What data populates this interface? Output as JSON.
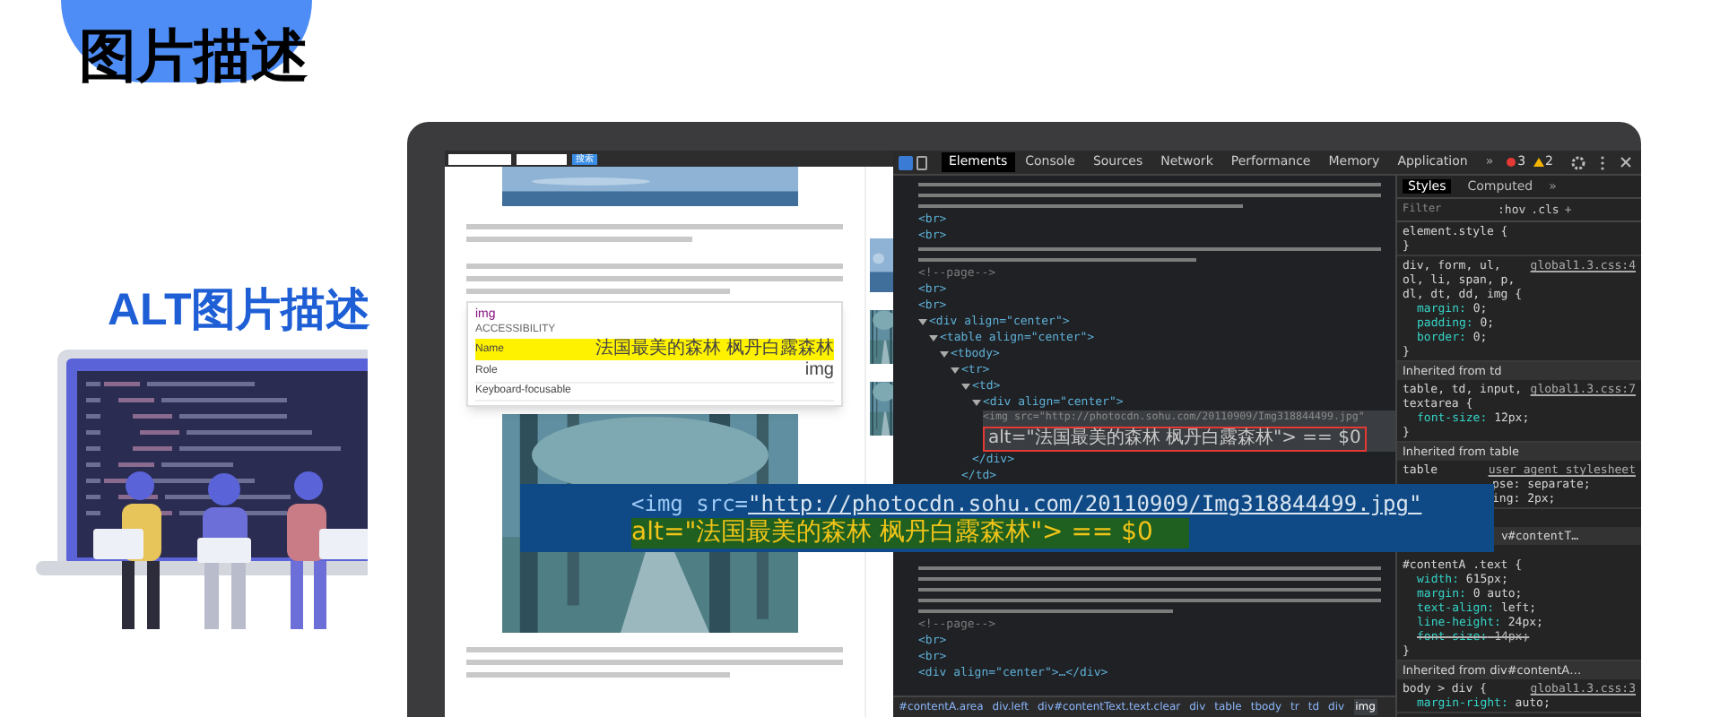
{
  "heading": "图片描述",
  "subheading": "ALT图片描述",
  "webpage": {
    "search_button": "搜索",
    "paragraphs_above": [
      {
        "kind": "short"
      },
      {
        "kind": "medium"
      }
    ],
    "tooltip": {
      "tag": "img",
      "section": "ACCESSIBILITY",
      "rows": [
        {
          "label": "Name",
          "value": "法国最美的森林 枫丹白露森林",
          "selected": true
        },
        {
          "label": "Role",
          "value": "img",
          "selected": false
        },
        {
          "label": "Keyboard-focusable",
          "selected": false
        }
      ]
    },
    "paragraphs_below": [
      {
        "kind": "medium"
      }
    ]
  },
  "devtools": {
    "tabs": [
      {
        "label": "Elements",
        "selected": true
      },
      {
        "label": "Console",
        "selected": false
      },
      {
        "label": "Sources",
        "selected": false
      },
      {
        "label": "Network",
        "selected": false
      },
      {
        "label": "Performance",
        "selected": false
      },
      {
        "label": "Memory",
        "selected": false
      },
      {
        "label": "Application",
        "selected": false
      }
    ],
    "more": "»",
    "errors": "3",
    "warnings": "2",
    "lines_above": [
      {
        "kind": "text-medium"
      },
      {
        "kind": "tag",
        "text": "<br>"
      },
      {
        "kind": "tag",
        "text": "<br>"
      },
      {
        "kind": "text-short"
      },
      {
        "kind": "comment",
        "text": "<!--page-->"
      },
      {
        "kind": "tag",
        "text": "<br>"
      },
      {
        "kind": "tag",
        "text": "<br>"
      },
      {
        "kind": "tag",
        "text": "<div align=\"center\">",
        "expanded": true,
        "children": [
          {
            "kind": "tag",
            "text": "<table align=\"center\">",
            "expanded": true,
            "children": [
              {
                "kind": "tag",
                "text": "<tbody>",
                "expanded": true,
                "children": [
                  {
                    "kind": "tag",
                    "text": "<tr>",
                    "expanded": true,
                    "children": [
                      {
                        "kind": "tag",
                        "text": "<td>",
                        "expanded": true,
                        "children": [
                          {
                            "kind": "tag",
                            "text": "<div align=\"center\">",
                            "expanded": true,
                            "children": [
                              {
                                "kind": "selected",
                                "text": "<img src=\"http://photocdn.sohu.com/20110909/Img318844499.jpg\"",
                                "boxed": false
                              },
                              {
                                "kind": "selected",
                                "text": "alt=\"法国最美的森林 枫丹白露森林\"> == $0",
                                "boxed": true
                              }
                            ]
                          },
                          {
                            "kind": "tag",
                            "text": "</div>"
                          }
                        ]
                      },
                      {
                        "kind": "tag",
                        "text": "</td>"
                      }
                    ]
                  }
                ]
              }
            ]
          }
        ]
      }
    ],
    "lines_below": [
      {
        "kind": "text-long"
      },
      {
        "kind": "comment",
        "text": "<!--page-->"
      },
      {
        "kind": "tag",
        "text": "<br>"
      },
      {
        "kind": "tag",
        "text": "<br>"
      },
      {
        "kind": "tag",
        "text": "<div align=\"center\">…</div>"
      }
    ],
    "breadcrumb": [
      {
        "label": "#contentA.area",
        "selected": false
      },
      {
        "label": "div.left",
        "selected": false
      },
      {
        "label": "div#contentText.text.clear",
        "selected": false
      },
      {
        "label": "div",
        "selected": false
      },
      {
        "label": "table",
        "selected": false
      },
      {
        "label": "tbody",
        "selected": false
      },
      {
        "label": "tr",
        "selected": false
      },
      {
        "label": "td",
        "selected": false
      },
      {
        "label": "div",
        "selected": false
      },
      {
        "label": "img",
        "selected": true
      }
    ],
    "styles": {
      "tabs": [
        {
          "label": "Styles",
          "selected": true
        },
        {
          "label": "Computed",
          "selected": false
        }
      ],
      "more": "»",
      "filter": {
        "placeholder": "Filter"
      },
      "hov": ":hov",
      "cls": ".cls",
      "add": "+",
      "blocks": [
        {
          "kind": "rule",
          "selector": "element.style {",
          "close": "}"
        },
        {
          "kind": "rule",
          "selector": "div, form, ul, ol, li, span, p, dl, dt, dd, img {",
          "source": "global1.3.css:4",
          "props": [
            {
              "name": "margin:",
              "value": "0;",
              "struck": false
            },
            {
              "name": "padding:",
              "value": "0;",
              "struck": false
            },
            {
              "name": "border:",
              "value": "0;",
              "struck": false
            }
          ],
          "close": "}"
        },
        {
          "kind": "inherited",
          "text": "Inherited from td"
        },
        {
          "kind": "rule",
          "selector": "table, td, input, textarea {",
          "source": "global1.3.css:7",
          "props": [
            {
              "name": "font-size:",
              "value": "12px;",
              "struck": false
            }
          ],
          "close": "}"
        },
        {
          "kind": "inherited",
          "text": "Inherited from table"
        },
        {
          "kind": "rule",
          "selector": "table",
          "source": "user agent stylesheet",
          "partials": [
            "pse: separate;",
            "ing: 2px;"
          ]
        },
        {
          "kind": "partial-header",
          "text": "v#contentT…"
        },
        {
          "kind": "rule",
          "selector": "#contentA .text {",
          "props": [
            {
              "name": "width:",
              "value": "615px;",
              "struck": false
            },
            {
              "name": "margin:",
              "value": "0 auto;",
              "struck": false
            },
            {
              "name": "text-align:",
              "value": "left;",
              "struck": false
            },
            {
              "name": "line-height:",
              "value": "24px;",
              "struck": false
            },
            {
              "name": "font-size:",
              "value": "14px;",
              "struck": true
            }
          ],
          "close": "}"
        },
        {
          "kind": "inherited",
          "text": "Inherited from div#contentA…"
        },
        {
          "kind": "rule",
          "selector": "body > div {",
          "source": "global1.3.css:3",
          "props": [
            {
              "name": "margin-right:",
              "value": "auto;",
              "struck": false
            }
          ]
        }
      ]
    }
  },
  "banner": {
    "line1_tag": "<img src=",
    "line1_url": "\"http://photocdn.sohu.com/20110909/Img318844499.jpg\"",
    "line2": "alt=\"法国最美的森林 枫丹白露森林\"> == $0"
  }
}
